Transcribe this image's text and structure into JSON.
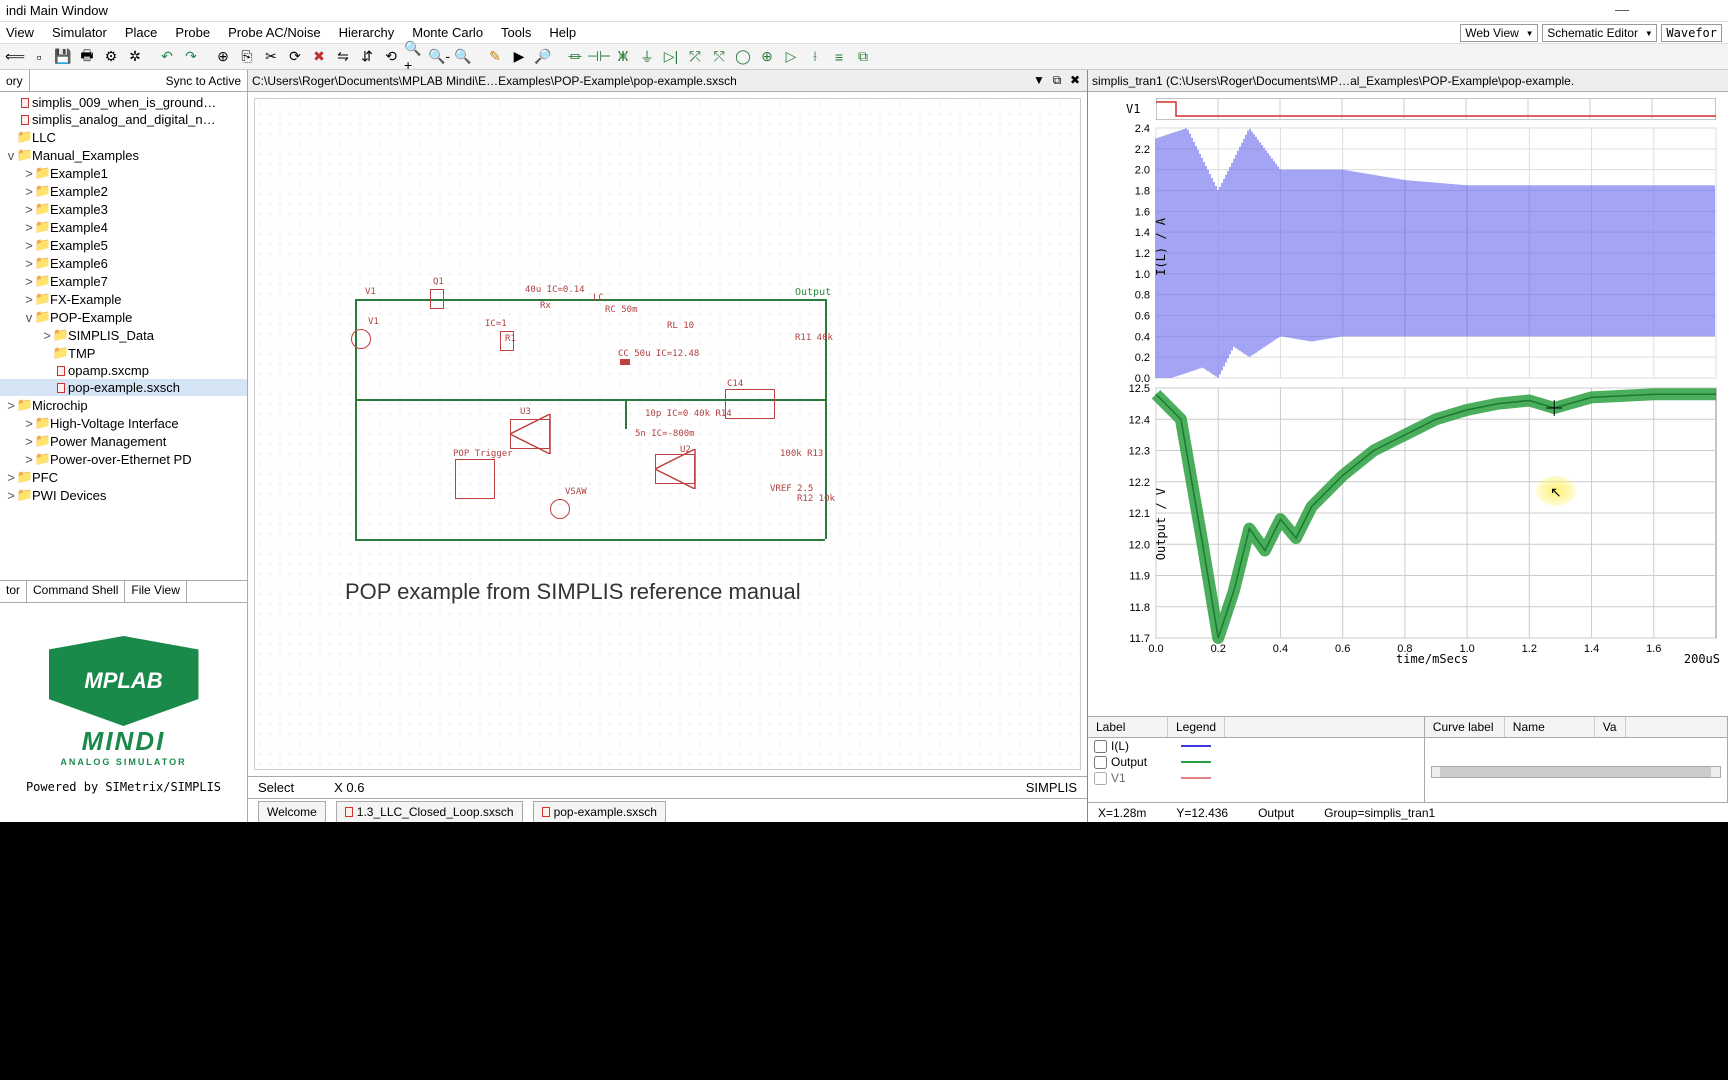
{
  "window": {
    "title": "indi Main Window",
    "min": "—",
    "max": "",
    "close": ""
  },
  "menu": [
    "View",
    "Simulator",
    "Place",
    "Probe",
    "Probe AC/Noise",
    "Hierarchy",
    "Monte Carlo",
    "Tools",
    "Help"
  ],
  "mode_combos": {
    "web": "Web View",
    "editor": "Schematic Editor",
    "wave": "Wavefor"
  },
  "sidebar": {
    "head_left": "ory",
    "head_right": "Sync to Active",
    "items": [
      {
        "d": 0,
        "t": "file",
        "l": "simplis_009_when_is_ground…"
      },
      {
        "d": 0,
        "t": "file",
        "l": "simplis_analog_and_digital_n…"
      },
      {
        "d": 0,
        "t": "folder",
        "tw": "",
        "l": "LLC"
      },
      {
        "d": 0,
        "t": "folder",
        "tw": "v",
        "l": "Manual_Examples"
      },
      {
        "d": 1,
        "t": "folder",
        "tw": ">",
        "l": "Example1"
      },
      {
        "d": 1,
        "t": "folder",
        "tw": ">",
        "l": "Example2"
      },
      {
        "d": 1,
        "t": "folder",
        "tw": ">",
        "l": "Example3"
      },
      {
        "d": 1,
        "t": "folder",
        "tw": ">",
        "l": "Example4"
      },
      {
        "d": 1,
        "t": "folder",
        "tw": ">",
        "l": "Example5"
      },
      {
        "d": 1,
        "t": "folder",
        "tw": ">",
        "l": "Example6"
      },
      {
        "d": 1,
        "t": "folder",
        "tw": ">",
        "l": "Example7"
      },
      {
        "d": 1,
        "t": "folder",
        "tw": ">",
        "l": "FX-Example"
      },
      {
        "d": 1,
        "t": "folder",
        "tw": "v",
        "l": "POP-Example"
      },
      {
        "d": 2,
        "t": "folder",
        "tw": ">",
        "l": "SIMPLIS_Data"
      },
      {
        "d": 2,
        "t": "folder",
        "tw": "",
        "l": "TMP"
      },
      {
        "d": 2,
        "t": "file",
        "l": "opamp.sxcmp"
      },
      {
        "d": 2,
        "t": "file",
        "l": "pop-example.sxsch",
        "sel": true
      },
      {
        "d": 0,
        "t": "folder",
        "tw": ">",
        "l": "Microchip"
      },
      {
        "d": 1,
        "t": "folder",
        "tw": ">",
        "l": "High-Voltage Interface"
      },
      {
        "d": 1,
        "t": "folder",
        "tw": ">",
        "l": "Power Management"
      },
      {
        "d": 1,
        "t": "folder",
        "tw": ">",
        "l": "Power-over-Ethernet PD"
      },
      {
        "d": 0,
        "t": "folder",
        "tw": ">",
        "l": "PFC"
      },
      {
        "d": 0,
        "t": "folder",
        "tw": ">",
        "l": "PWI Devices"
      }
    ],
    "tabs": [
      "tor",
      "Command Shell",
      "File View"
    ],
    "logo_top": "MPLAB",
    "logo_mid": "MINDI",
    "logo_sub": "ANALOG SIMULATOR",
    "powered": "Powered by SIMetrix/SIMPLIS"
  },
  "schematic": {
    "path": "C:\\Users\\Roger\\Documents\\MPLAB Mindi\\E…Examples\\POP-Example\\pop-example.sxsch",
    "note": "POP example from SIMPLIS reference manual",
    "labels": {
      "v1": "V1",
      "q1": "Q1",
      "l1": "40u IC=0.14",
      "rx": "Rx",
      "lc": "LC",
      "rc": "RC 50m",
      "rl": "RL 10",
      "r11": "R11 40k",
      "cc": "CC 50u IC=12.48",
      "ic1": "IC=1",
      "r1": "R1",
      "u3": "U3",
      "c14": "C14",
      "r14": "10p IC=0 40k R14",
      "u2": "U2",
      "r13": "100k R13",
      "vref": "VREF 2.5",
      "r12": "R12 10k",
      "vsaw": "VSAW",
      "pop": "POP Trigger",
      "cap2": "5n IC=-800m",
      "output": "Output"
    },
    "status_mode": "Select",
    "status_x": "X 0.6",
    "status_engine": "SIMPLIS",
    "tabs": [
      "Welcome",
      "1.3_LLC_Closed_Loop.sxsch",
      "pop-example.sxsch"
    ]
  },
  "wave": {
    "path": "simplis_tran1 (C:\\Users\\Roger\\Documents\\MP…al_Examples\\POP-Example\\pop-example.",
    "v1_label": "V1",
    "il_label": "I(L) / A",
    "out_label": "Output / V",
    "x_label": "time/mSecs",
    "x_scale": "200uS",
    "status": {
      "x": "X=1.28m",
      "y": "Y=12.436",
      "curve": "Output",
      "group": "Group=simplis_tran1"
    },
    "legend_head": [
      "Label",
      "Legend"
    ],
    "curve_head": [
      "Curve label",
      "Name",
      "Va"
    ],
    "legend_items": [
      {
        "name": "I(L)",
        "color": "#3a3ae0"
      },
      {
        "name": "Output",
        "color": "#2aa040"
      },
      {
        "name": "V1",
        "color": "#d03030",
        "partial": true
      }
    ]
  },
  "chart_data": [
    {
      "type": "line",
      "name": "V1 (digital)",
      "x_range": [
        0.0,
        1.8
      ],
      "y_range": [
        0,
        1
      ],
      "note": "digital strip, mostly low with initial high segment"
    },
    {
      "type": "line",
      "name": "I(L)",
      "xlabel": "time/mSecs",
      "ylabel": "I(L) / A",
      "ylim": [
        0.0,
        2.4
      ],
      "xlim": [
        0.0,
        1.8
      ],
      "yticks": [
        0.0,
        0.2,
        0.4,
        0.6,
        0.8,
        1.0,
        1.2,
        1.4,
        1.6,
        1.8,
        2.0,
        2.2,
        2.4
      ],
      "series": [
        {
          "name": "I(L)",
          "color": "#3a3ae0",
          "envelope_upper": [
            [
              0.0,
              2.3
            ],
            [
              0.1,
              2.4
            ],
            [
              0.2,
              1.8
            ],
            [
              0.3,
              2.4
            ],
            [
              0.4,
              2.0
            ],
            [
              0.6,
              2.0
            ],
            [
              0.8,
              1.9
            ],
            [
              1.0,
              1.85
            ],
            [
              1.2,
              1.85
            ],
            [
              1.4,
              1.85
            ],
            [
              1.6,
              1.85
            ],
            [
              1.8,
              1.85
            ]
          ],
          "envelope_lower": [
            [
              0.0,
              0.0
            ],
            [
              0.05,
              0.0
            ],
            [
              0.15,
              0.1
            ],
            [
              0.2,
              0.0
            ],
            [
              0.25,
              0.3
            ],
            [
              0.3,
              0.2
            ],
            [
              0.4,
              0.4
            ],
            [
              0.5,
              0.35
            ],
            [
              0.6,
              0.4
            ],
            [
              0.8,
              0.4
            ],
            [
              1.0,
              0.4
            ],
            [
              1.2,
              0.4
            ],
            [
              1.4,
              0.4
            ],
            [
              1.6,
              0.4
            ],
            [
              1.8,
              0.4
            ]
          ]
        }
      ]
    },
    {
      "type": "line",
      "name": "Output",
      "xlabel": "time/mSecs",
      "ylabel": "Output / V",
      "ylim": [
        11.7,
        12.5
      ],
      "xlim": [
        0.0,
        1.8
      ],
      "yticks": [
        11.7,
        11.8,
        11.9,
        12.0,
        12.1,
        12.2,
        12.3,
        12.4,
        12.5
      ],
      "xticks": [
        0.0,
        0.2,
        0.4,
        0.6,
        0.8,
        1.0,
        1.2,
        1.4,
        1.6
      ],
      "series": [
        {
          "name": "Output",
          "color": "#2aa040",
          "points": [
            [
              0.0,
              12.48
            ],
            [
              0.08,
              12.4
            ],
            [
              0.15,
              12.0
            ],
            [
              0.2,
              11.7
            ],
            [
              0.25,
              11.85
            ],
            [
              0.3,
              12.05
            ],
            [
              0.35,
              11.98
            ],
            [
              0.4,
              12.08
            ],
            [
              0.45,
              12.02
            ],
            [
              0.5,
              12.12
            ],
            [
              0.6,
              12.22
            ],
            [
              0.7,
              12.3
            ],
            [
              0.8,
              12.35
            ],
            [
              0.9,
              12.4
            ],
            [
              1.0,
              12.43
            ],
            [
              1.1,
              12.45
            ],
            [
              1.2,
              12.46
            ],
            [
              1.28,
              12.436
            ],
            [
              1.4,
              12.47
            ],
            [
              1.6,
              12.48
            ],
            [
              1.8,
              12.48
            ]
          ]
        }
      ],
      "cursor": {
        "x": 1.28,
        "y": 12.436
      }
    }
  ]
}
